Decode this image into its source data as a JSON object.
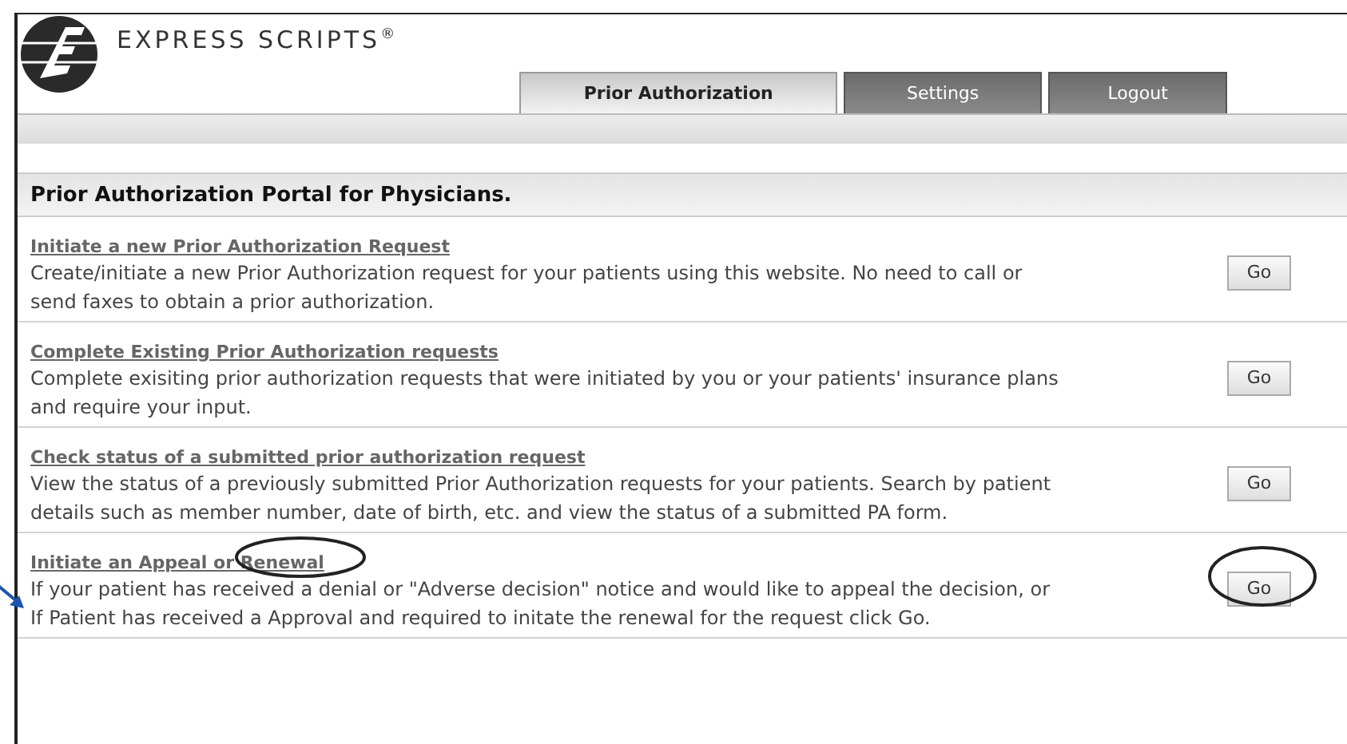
{
  "brand": {
    "name": "EXPRESS SCRIPTS$^{®}$"
  },
  "tabs": [
    {
      "label": "Prior Authorization",
      "selected": true
    },
    {
      "label": "Settings",
      "selected": false
    },
    {
      "label": "Logout",
      "selected": false
    }
  ],
  "portal": {
    "title": "Prior Authorization Portal for Physicians.",
    "options": [
      {
        "title": "Initiate a new Prior Authorization Request",
        "description": "Create/initiate a new Prior Authorization request for your patients using this website. No need to call or send faxes to obtain a prior authorization.",
        "button": "Go",
        "circled": false
      },
      {
        "title": "Complete Existing Prior Authorization requests",
        "description": "Complete exisiting prior authorization requests that were initiated by you or your patients' insurance plans and require your input.",
        "button": "Go",
        "circled": false
      },
      {
        "title": "Check status of a submitted prior authorization request",
        "description": "View the status of a previously submitted Prior Authorization requests for your patients. Search by patient details such as member number, date of birth, etc. and view the status of a submitted PA form.",
        "button": "Go",
        "circled": false
      },
      {
        "title": "Initiate an Appeal or Renewal",
        "description": "If your patient has received a denial or \"Adverse decision\" notice and would like to appeal the decision, or If Patient has received a Approval and required to initate the renewal for the request click Go.",
        "button": "Go",
        "circled": true
      }
    ]
  },
  "pointer_arrow": true
}
